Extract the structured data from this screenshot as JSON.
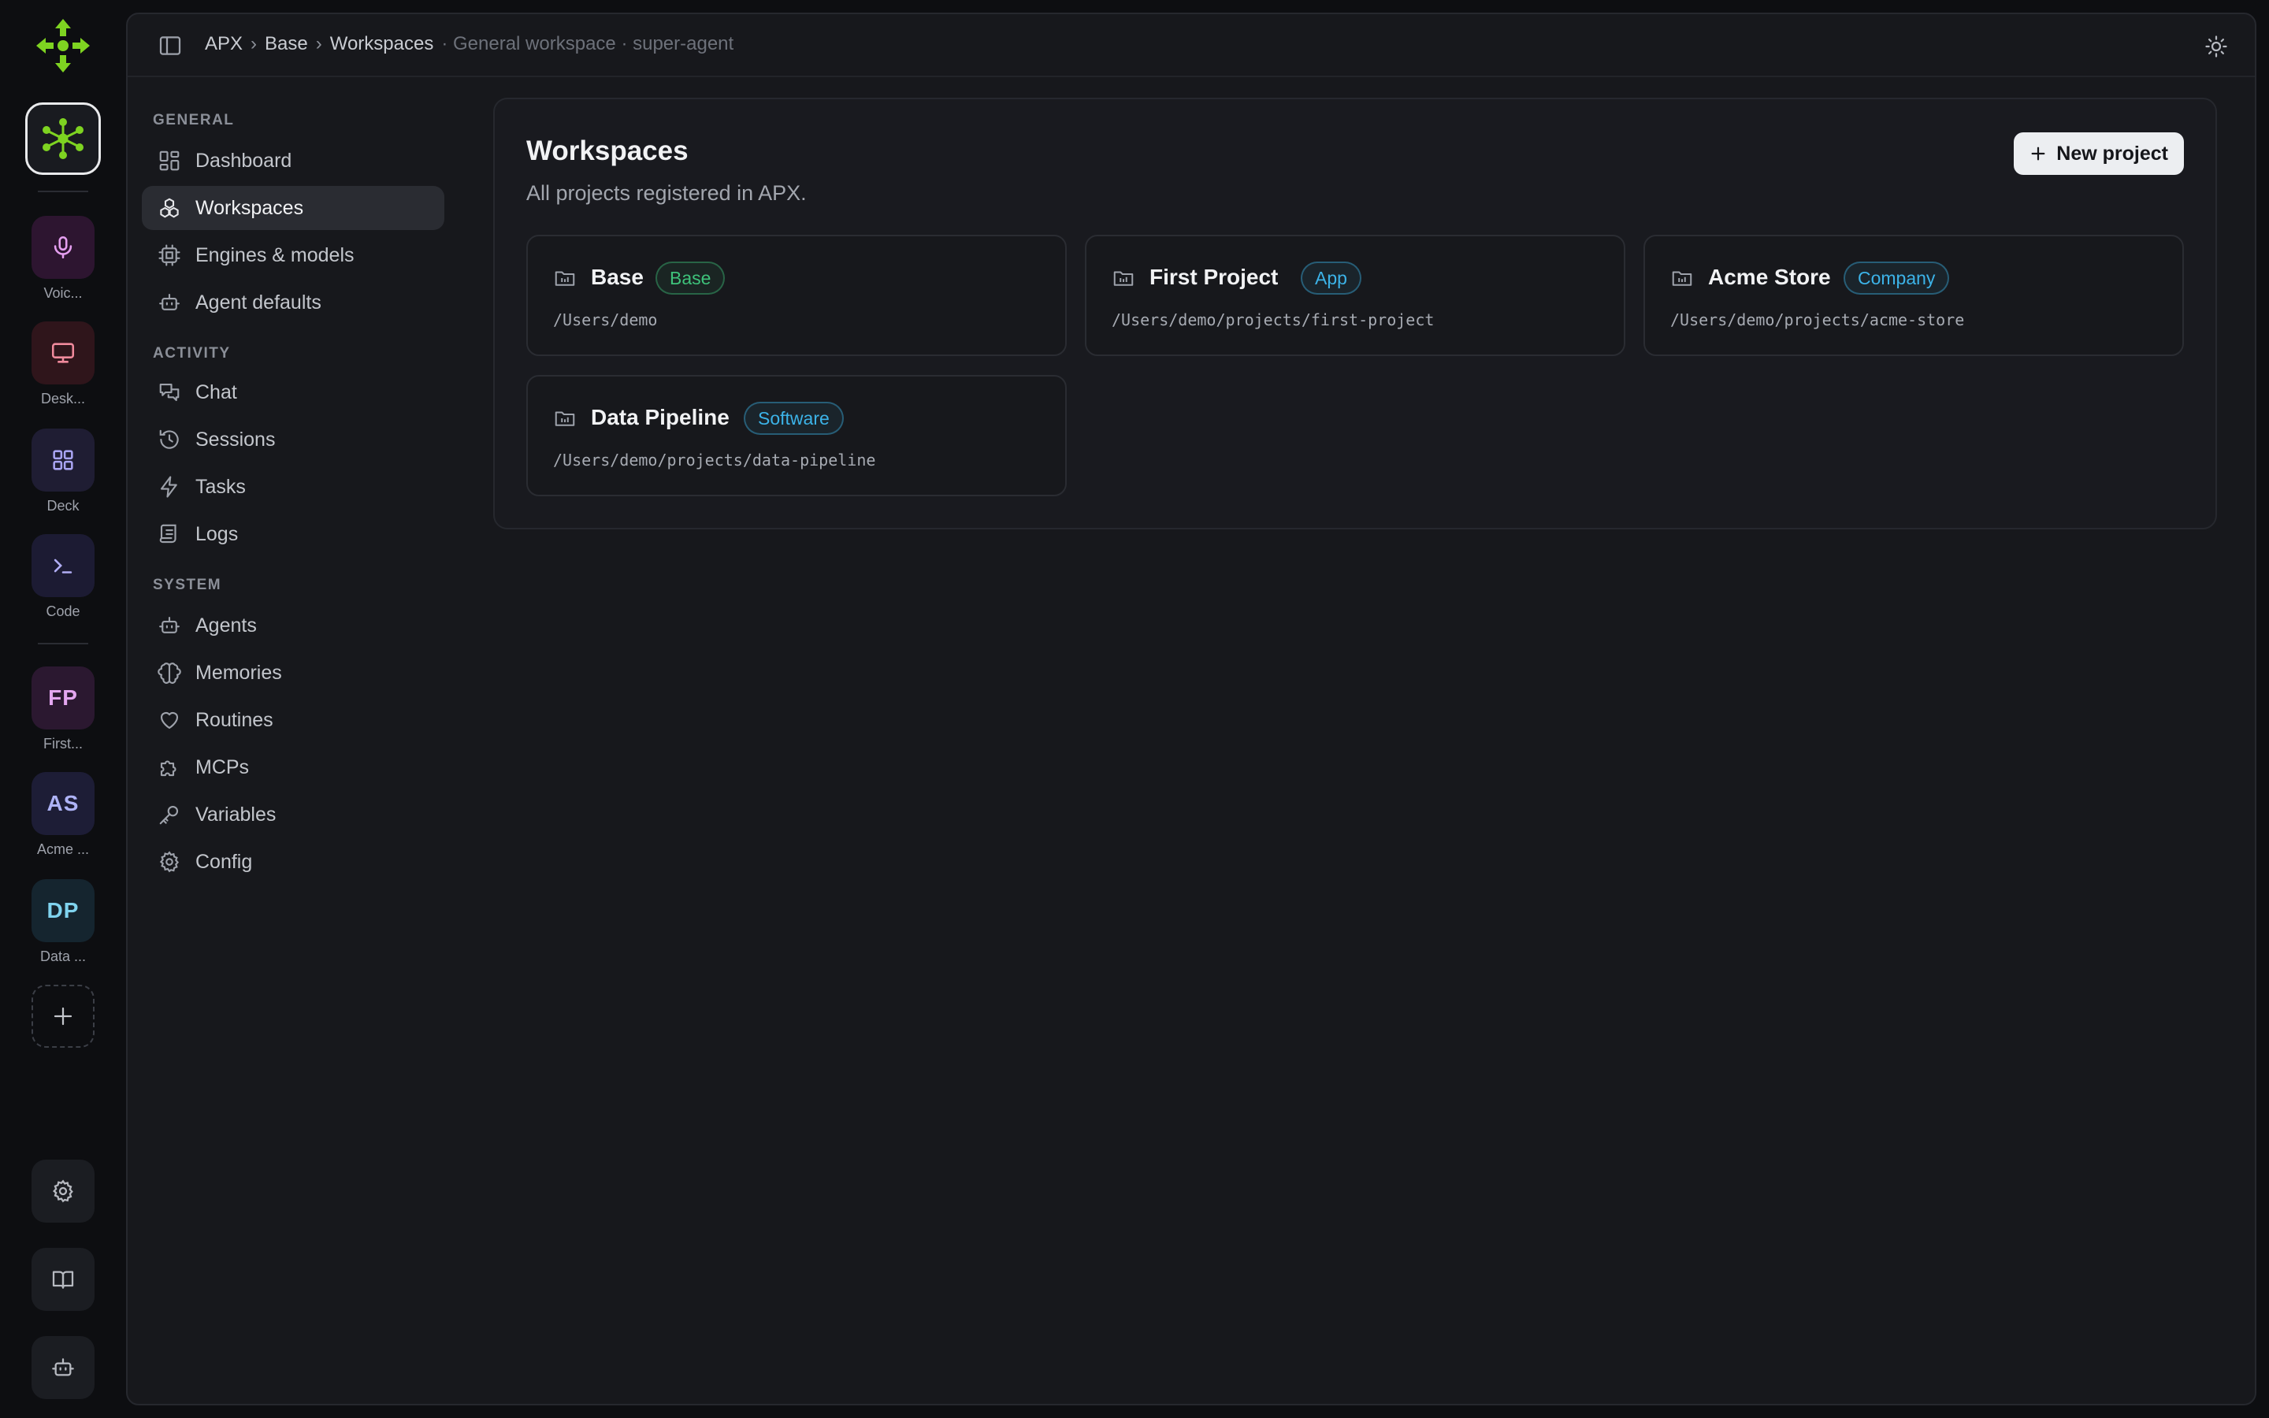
{
  "rail": {
    "apps": [
      {
        "id": "voice",
        "label": "Voic...",
        "bg": "#2d1530",
        "fg": "#e59ff0"
      },
      {
        "id": "desktop",
        "label": "Desk...",
        "bg": "#2f151b",
        "fg": "#f08a9c"
      },
      {
        "id": "deck",
        "label": "Deck",
        "bg": "#1f1d33",
        "fg": "#a9a4f2"
      },
      {
        "id": "code",
        "label": "Code",
        "bg": "#1c1b33",
        "fg": "#b1aef5"
      }
    ],
    "projects": [
      {
        "initials": "FP",
        "label": "First...",
        "bg": "#2b1830",
        "fg": "#e4a6f0"
      },
      {
        "initials": "AS",
        "label": "Acme ...",
        "bg": "#1d1d36",
        "fg": "#aeb3f6"
      },
      {
        "initials": "DP",
        "label": "Data ...",
        "bg": "#15252f",
        "fg": "#7fd3ee"
      }
    ],
    "accent": "#7ed321"
  },
  "topbar": {
    "crumbs": [
      "APX",
      "Base",
      "Workspaces"
    ],
    "separator": "›",
    "context": "· General workspace · super-agent"
  },
  "sidebar": {
    "sections": {
      "general": "GENERAL",
      "activity": "ACTIVITY",
      "system": "SYSTEM"
    },
    "items": {
      "dashboard": "Dashboard",
      "workspaces": "Workspaces",
      "engines": "Engines & models",
      "agent_defaults": "Agent defaults",
      "chat": "Chat",
      "sessions": "Sessions",
      "tasks": "Tasks",
      "logs": "Logs",
      "agents": "Agents",
      "memories": "Memories",
      "routines": "Routines",
      "mcps": "MCPs",
      "variables": "Variables",
      "config": "Config"
    }
  },
  "main": {
    "title": "Workspaces",
    "subtitle": "All projects registered in APX.",
    "new_button": "New project",
    "cards": [
      {
        "name": "Base",
        "badge": "Base",
        "badge_color": "#3ec27a",
        "path": "/Users/demo"
      },
      {
        "name": "First Project",
        "badge": "App",
        "badge_color": "#3cb3e8",
        "path": "/Users/demo/projects/first-project"
      },
      {
        "name": "Acme Store",
        "badge": "Company",
        "badge_color": "#3cb3e8",
        "path": "/Users/demo/projects/acme-store"
      },
      {
        "name": "Data Pipeline",
        "badge": "Software",
        "badge_color": "#3cb3e8",
        "path": "/Users/demo/projects/data-pipeline"
      }
    ]
  }
}
